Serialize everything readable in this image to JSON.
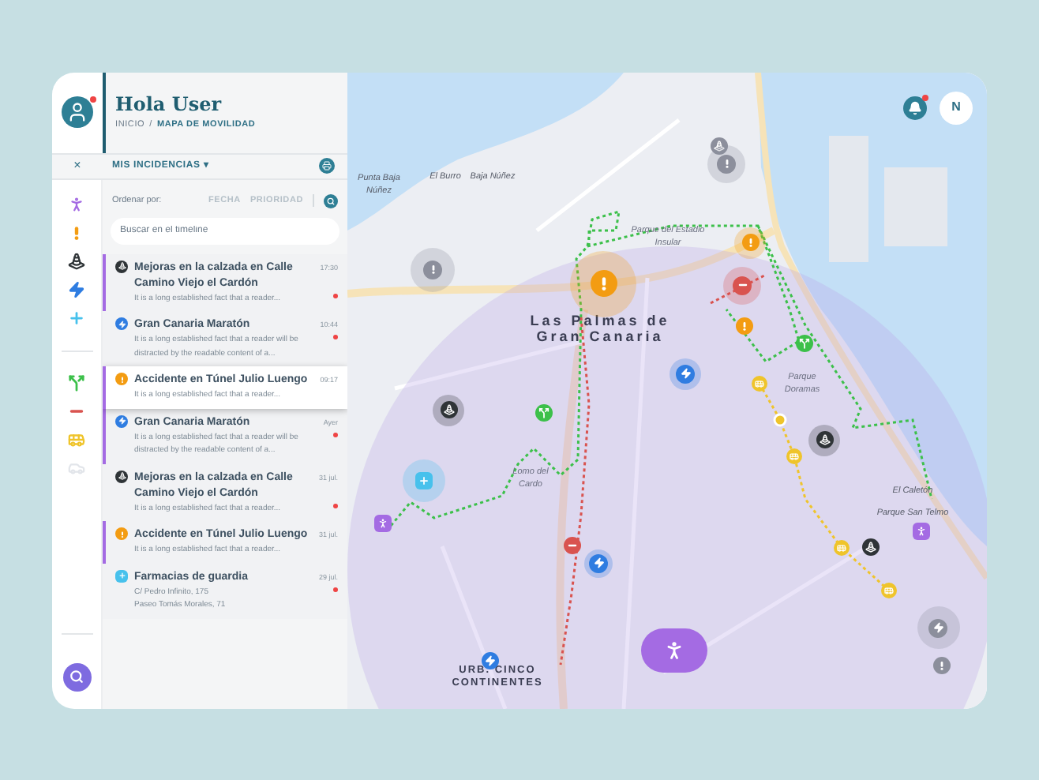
{
  "user": {
    "greeting": "Hola User",
    "notification": true
  },
  "breadcrumb": [
    "INICIO",
    "/",
    "MAPA DE MOVILIDAD"
  ],
  "panel": {
    "close": "×",
    "title": "MIS INCIDENCIAS",
    "caret": "▾"
  },
  "sort": {
    "label": "Ordenar por:",
    "options": [
      {
        "label": "FECHA",
        "selected": false
      },
      {
        "label": "PRIORIDAD",
        "selected": false
      }
    ]
  },
  "search": {
    "placeholder": "Buscar en el timeline"
  },
  "filters_top": [
    {
      "kind": "person",
      "active": true
    },
    {
      "kind": "alert",
      "active": true
    },
    {
      "kind": "cone",
      "active": true
    },
    {
      "kind": "bolt",
      "active": true
    },
    {
      "kind": "pharmacy",
      "active": true
    }
  ],
  "filters_bottom": [
    {
      "kind": "fork",
      "active": true
    },
    {
      "kind": "noentry",
      "active": true
    },
    {
      "kind": "bus",
      "active": true
    },
    {
      "kind": "car",
      "active": false
    }
  ],
  "incidents": [
    {
      "kind": "cone",
      "title": "Mejoras en la calzada en Calle Camino Viejo el Cardón",
      "time": "17:30",
      "lines": [
        "It is a long established fact that a reader..."
      ],
      "unread": true,
      "flagged": true,
      "selected": false
    },
    {
      "kind": "bolt",
      "title": "Gran Canaria Maratón",
      "time": "10:44",
      "lines": [
        "It is a long established fact that a reader will be distracted by the readable content of a..."
      ],
      "unread": true,
      "flagged": false,
      "selected": false
    },
    {
      "kind": "alert",
      "title": "Accidente en Túnel Julio Luengo",
      "time": "09:17",
      "lines": [
        "It is a long established fact that a reader..."
      ],
      "unread": false,
      "flagged": true,
      "selected": true
    },
    {
      "kind": "bolt",
      "title": "Gran Canaria Maratón",
      "time": "Ayer",
      "lines": [
        "It is a long established fact that a reader will be distracted by the readable content of a..."
      ],
      "unread": true,
      "flagged": true,
      "selected": false
    },
    {
      "kind": "cone",
      "title": "Mejoras en la calzada en Calle Camino Viejo el Cardón",
      "time": "31 jul.",
      "lines": [
        "It is a long established fact that a reader..."
      ],
      "unread": true,
      "flagged": false,
      "selected": false
    },
    {
      "kind": "alert",
      "title": "Accidente en Túnel Julio Luengo",
      "time": "31 jul.",
      "lines": [
        "It is a long established fact that a reader..."
      ],
      "unread": false,
      "flagged": true,
      "selected": false
    },
    {
      "kind": "pharmacy",
      "title": "Farmacias de guardia",
      "time": "29 jul.",
      "lines": [
        "C/ Pedro Infinito, 175",
        "Paseo Tomás Morales, 71"
      ],
      "unread": true,
      "flagged": false,
      "selected": false
    }
  ],
  "map": {
    "labels": [
      {
        "text": "Punta Baja Núñez",
        "kind": "place"
      },
      {
        "text": "El Burro",
        "kind": "place"
      },
      {
        "text": "Baja Núñez",
        "kind": "place"
      },
      {
        "text": "Parque del Estadio Insular",
        "kind": "park"
      },
      {
        "text": "Las Palmas de Gran Canaria",
        "kind": "city"
      },
      {
        "text": "Parque Doramas",
        "kind": "park"
      },
      {
        "text": "Lomo del Cardo",
        "kind": "park"
      },
      {
        "text": "El Caletón",
        "kind": "place"
      },
      {
        "text": "Parque San Telmo",
        "kind": "place"
      },
      {
        "text": "URB. CINCO CONTINENTES",
        "kind": "district"
      }
    ]
  },
  "header_right": {
    "bell_unread": true,
    "avatar": "N"
  }
}
